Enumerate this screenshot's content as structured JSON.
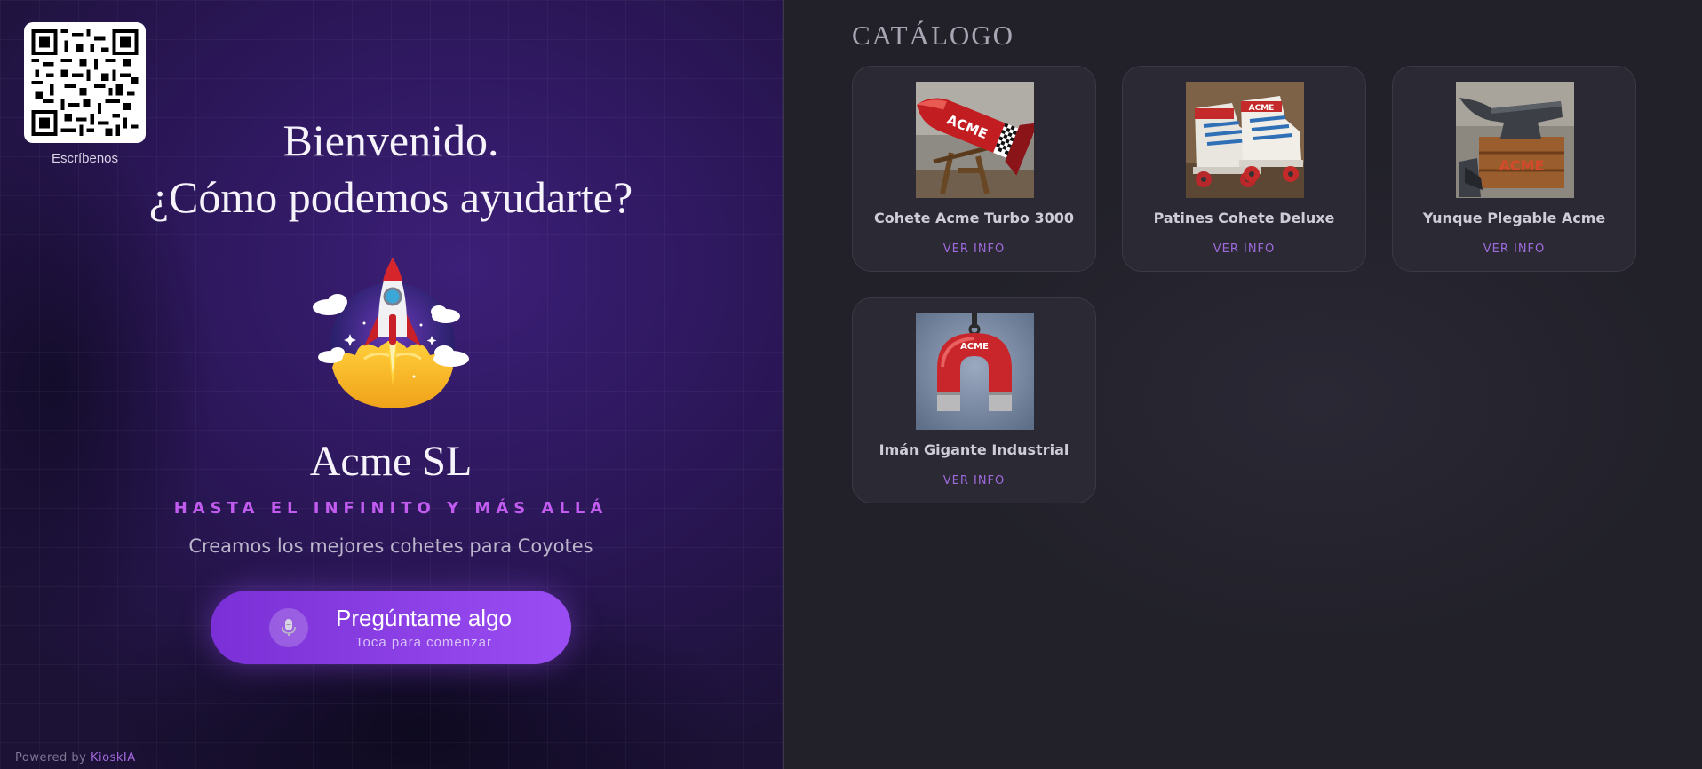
{
  "qr": {
    "label": "Escríbenos"
  },
  "welcome": {
    "line1": "Bienvenido.",
    "line2": "¿Cómo podemos ayudarte?"
  },
  "company": {
    "name": "Acme SL",
    "slogan": "HASTA EL INFINITO Y MÁS ALLÁ",
    "tagline": "Creamos los mejores cohetes para Coyotes",
    "logo_icon": "rocket-launch-icon"
  },
  "ask_button": {
    "title": "Pregúntame algo",
    "subtitle": "Toca para comenzar",
    "icon": "microphone-icon"
  },
  "footer": {
    "prefix": "Powered by",
    "brand": "KioskIA"
  },
  "catalog": {
    "title": "CATÁLOGO",
    "products": [
      {
        "name": "Cohete Acme Turbo 3000",
        "action": "VER INFO",
        "image": "rocket-cannon-image",
        "image_text": "ACME"
      },
      {
        "name": "Patines Cohete Deluxe",
        "action": "VER INFO",
        "image": "roller-skates-image",
        "image_text": "ACME"
      },
      {
        "name": "Yunque Plegable Acme",
        "action": "VER INFO",
        "image": "anvil-image",
        "image_text": "ACME"
      },
      {
        "name": "Imán Gigante Industrial",
        "action": "VER INFO",
        "image": "magnet-image",
        "image_text": "ACME"
      }
    ]
  },
  "colors": {
    "accent": "#9a4df2",
    "slogan": "#c25cf0",
    "link": "#9f6adc",
    "left_bg": "#2a1656",
    "right_bg": "#22212a"
  }
}
